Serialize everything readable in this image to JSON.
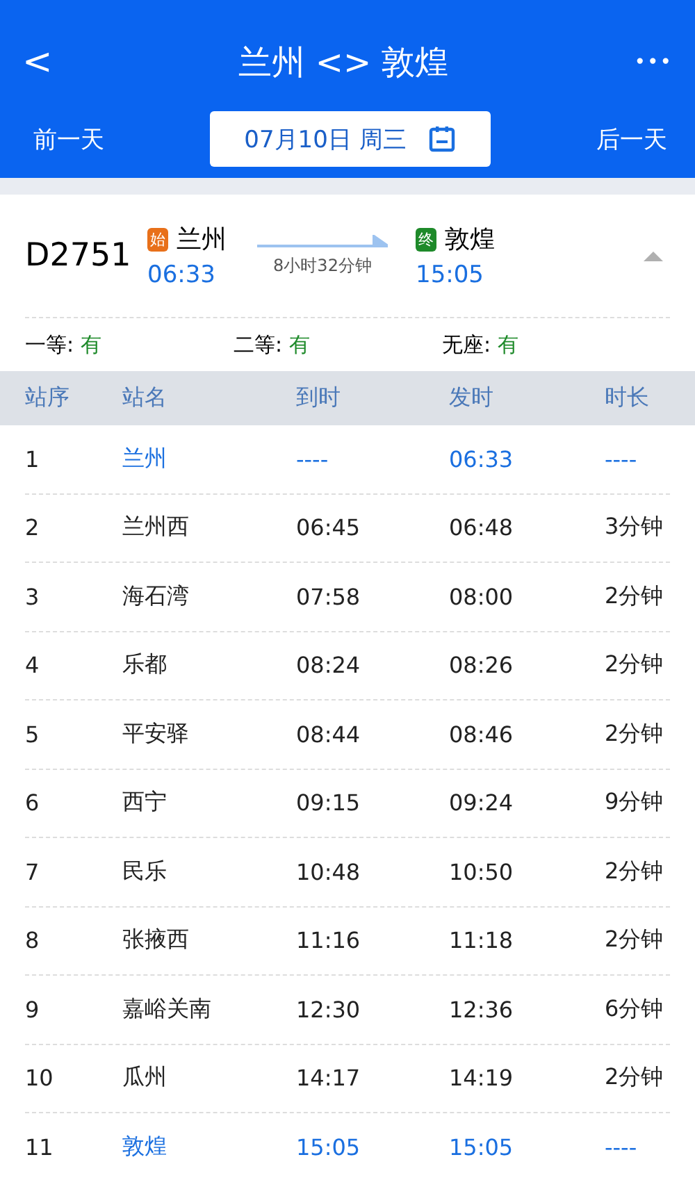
{
  "header": {
    "back": "<",
    "title": "兰州 <> 敦煌",
    "more": "•••"
  },
  "date_bar": {
    "prev": "前一天",
    "date": "07月10日 周三",
    "next": "后一天"
  },
  "train": {
    "number": "D2751",
    "from_badge": "始",
    "from": "兰州",
    "depart": "06:33",
    "duration": "8小时32分钟",
    "to_badge": "终",
    "to": "敦煌",
    "arrive": "15:05",
    "expanded": true
  },
  "seats": [
    {
      "label": "一等:",
      "value": "有"
    },
    {
      "label": "二等:",
      "value": "有"
    },
    {
      "label": "无座:",
      "value": "有"
    }
  ],
  "table": {
    "columns": [
      "站序",
      "站名",
      "到时",
      "发时",
      "时长"
    ],
    "rows": [
      {
        "cells": [
          "1",
          "兰州",
          "----",
          "06:33",
          "----"
        ],
        "highlighted": true
      },
      {
        "cells": [
          "2",
          "兰州西",
          "06:45",
          "06:48",
          "3分钟"
        ],
        "highlighted": false
      },
      {
        "cells": [
          "3",
          "海石湾",
          "07:58",
          "08:00",
          "2分钟"
        ],
        "highlighted": false
      },
      {
        "cells": [
          "4",
          "乐都",
          "08:24",
          "08:26",
          "2分钟"
        ],
        "highlighted": false
      },
      {
        "cells": [
          "5",
          "平安驿",
          "08:44",
          "08:46",
          "2分钟"
        ],
        "highlighted": false
      },
      {
        "cells": [
          "6",
          "西宁",
          "09:15",
          "09:24",
          "9分钟"
        ],
        "highlighted": false
      },
      {
        "cells": [
          "7",
          "民乐",
          "10:48",
          "10:50",
          "2分钟"
        ],
        "highlighted": false
      },
      {
        "cells": [
          "8",
          "张掖西",
          "11:16",
          "11:18",
          "2分钟"
        ],
        "highlighted": false
      },
      {
        "cells": [
          "9",
          "嘉峪关南",
          "12:30",
          "12:36",
          "6分钟"
        ],
        "highlighted": false
      },
      {
        "cells": [
          "10",
          "瓜州",
          "14:17",
          "14:19",
          "2分钟"
        ],
        "highlighted": false
      },
      {
        "cells": [
          "11",
          "敦煌",
          "15:05",
          "15:05",
          "----"
        ],
        "highlighted": true
      }
    ]
  }
}
